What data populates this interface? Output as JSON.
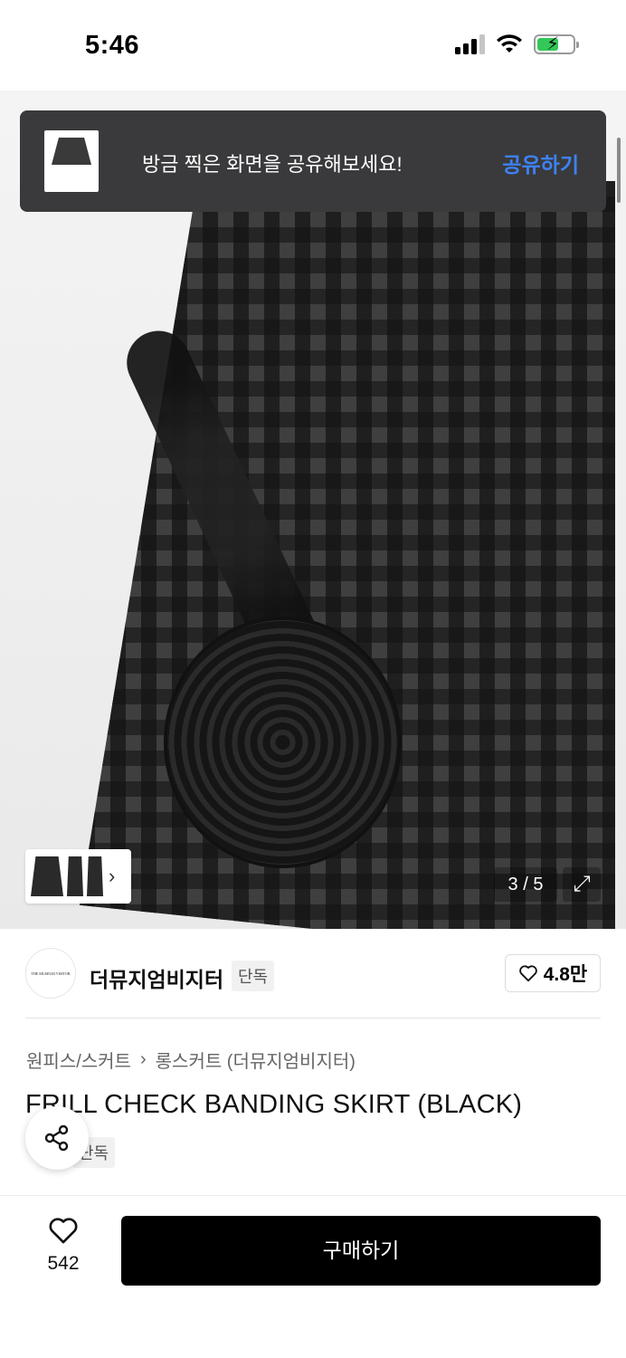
{
  "status_bar": {
    "time": "5:46",
    "icons": [
      "cellular-signal-icon",
      "wifi-icon",
      "battery-charging-icon"
    ],
    "battery_color": "#34c759"
  },
  "hero": {
    "counter": "3 / 5",
    "icons": [
      "expand-icon",
      "chevron-right-icon"
    ]
  },
  "toast": {
    "message": "방금 찍은 화면을 공유해보세요!",
    "action": "공유하기",
    "action_color": "#3d82f6"
  },
  "brand": {
    "logo_text": "THE MUSEUM VISITOR",
    "name": "더뮤지엄비지터",
    "badge": "단독",
    "likes": "4.8만"
  },
  "product": {
    "breadcrumb": [
      "원피스/스커트",
      "롱스커트 (더뮤지엄비지터)"
    ],
    "title": "FRILL CHECK BANDING SKIRT (BLACK)",
    "badge": "단독"
  },
  "bottom_bar": {
    "wish_count": "542",
    "buy_label": "구매하기"
  }
}
